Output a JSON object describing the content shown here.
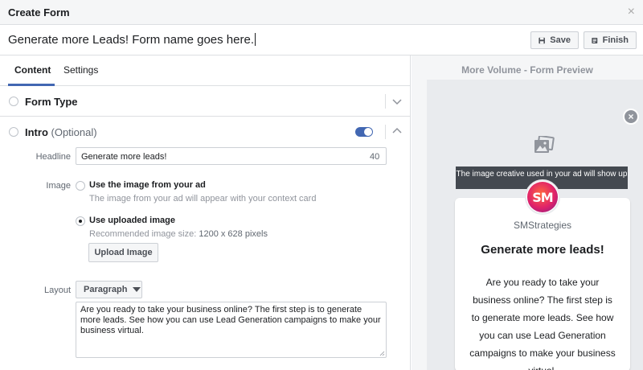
{
  "window": {
    "title": "Create Form",
    "close_glyph": "×"
  },
  "namebar": {
    "form_name": "Generate more Leads! Form name goes here.",
    "save_label": "Save",
    "finish_label": "Finish"
  },
  "tabs": [
    {
      "label": "Content",
      "active": true
    },
    {
      "label": "Settings",
      "active": false
    }
  ],
  "sections": {
    "form_type": {
      "title": "Form Type"
    },
    "intro": {
      "title": "Intro",
      "optional": "(Optional)",
      "enabled": true,
      "headline_label": "Headline",
      "headline_value": "Generate more leads!",
      "headline_count": "40",
      "image_label": "Image",
      "image_options": [
        {
          "label": "Use the image from your ad",
          "help": "The image from your ad will appear with your context card",
          "selected": false
        },
        {
          "label": "Use uploaded image",
          "help_prefix": "Recommended image size: ",
          "help_value": "1200 x 628 pixels",
          "selected": true
        }
      ],
      "upload_label": "Upload Image",
      "layout_label": "Layout",
      "layout_value": "Paragraph",
      "body_text": "Are you ready to take your business online? The first step is to generate more leads. See how you can use Lead Generation campaigns to make your business virtual."
    }
  },
  "preview": {
    "title": "More Volume - Form Preview",
    "close_glyph": "×",
    "tooltip": "The image creative used in your ad will show up",
    "avatar_text": "SM",
    "company": "SMStrategies",
    "headline": "Generate more leads!",
    "body": "Are you ready to take your business online? The first step is to generate more leads. See how you can use Lead Generation campaigns to make your business virtual."
  },
  "colors": {
    "accent": "#4267b2",
    "tooltip_bg": "#444950",
    "preview_bg": "#e9ebee"
  },
  "icons": [
    "close-icon",
    "save-icon",
    "finish-icon",
    "chevron-down-icon",
    "chevron-up-icon",
    "image-icon",
    "resize-grip-icon",
    "dropdown-caret-icon"
  ]
}
